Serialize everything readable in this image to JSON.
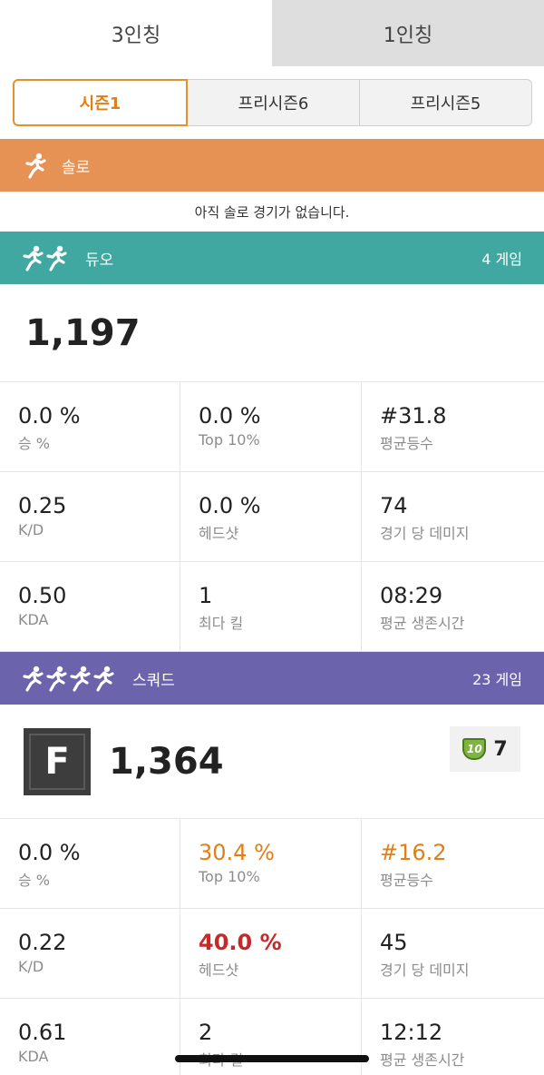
{
  "perspective_tabs": [
    {
      "label": "3인칭",
      "active": true
    },
    {
      "label": "1인칭",
      "active": false
    }
  ],
  "seasons": [
    {
      "label": "시즌1",
      "selected": true
    },
    {
      "label": "프리시즌6",
      "selected": false
    },
    {
      "label": "프리시즌5",
      "selected": false
    }
  ],
  "solo": {
    "name": "솔로",
    "empty_message": "아직 솔로 경기가 없습니다.",
    "color": "#e69254"
  },
  "duo": {
    "name": "듀오",
    "games": "4 게임",
    "rating": "1,197",
    "color": "#41a8a1",
    "stats": [
      {
        "value": "0.0 %",
        "label": "승 %"
      },
      {
        "value": "0.0 %",
        "label": "Top 10%"
      },
      {
        "value": "#31.8",
        "label": "평균등수"
      },
      {
        "value": "0.25",
        "label": "K/D"
      },
      {
        "value": "0.0 %",
        "label": "헤드샷"
      },
      {
        "value": "74",
        "label": "경기 당 데미지"
      },
      {
        "value": "0.50",
        "label": "KDA"
      },
      {
        "value": "1",
        "label": "최다 킬"
      },
      {
        "value": "08:29",
        "label": "평균 생존시간"
      }
    ]
  },
  "squad": {
    "name": "스쿼드",
    "games": "23 게임",
    "rating": "1,364",
    "tier_letter": "F",
    "badge_icon": "top10-shield-icon",
    "badge_shield_text": "10",
    "badge_count": "7",
    "color": "#6b63ab",
    "stats": [
      {
        "value": "0.0 %",
        "label": "승 %",
        "style": ""
      },
      {
        "value": "30.4 %",
        "label": "Top 10%",
        "style": "orange"
      },
      {
        "value": "#16.2",
        "label": "평균등수",
        "style": "orange"
      },
      {
        "value": "0.22",
        "label": "K/D",
        "style": ""
      },
      {
        "value": "40.0 %",
        "label": "헤드샷",
        "style": "red"
      },
      {
        "value": "45",
        "label": "경기 당 데미지",
        "style": ""
      },
      {
        "value": "0.61",
        "label": "KDA",
        "style": ""
      },
      {
        "value": "2",
        "label": "최다 킬",
        "style": ""
      },
      {
        "value": "12:12",
        "label": "평균 생존시간",
        "style": ""
      }
    ]
  },
  "colors": {
    "accent_orange": "#e07f17",
    "highlight_red": "#c32a2a"
  }
}
